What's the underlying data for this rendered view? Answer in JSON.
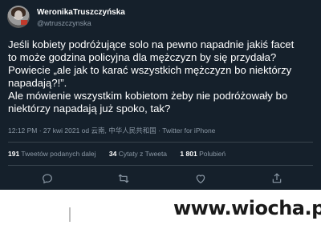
{
  "author": {
    "display_name": "WeronikaTruszczyńska",
    "handle": "@wtruszczynska"
  },
  "tweet": {
    "lines": [
      "Jeśli kobiety podróżujące solo na pewno napadnie jakiś facet",
      "to może godzina policyjna dla mężczyzn by się przydała?",
      "Powiecie „ale jak to karać wszystkich mężczyzn bo niektórzy",
      "napadają?!”.",
      "Ale mówienie wszystkim kobietom żeby nie podróżowały bo",
      "niektórzy napadają już spoko, tak?"
    ],
    "meta": "12:12 PM · 27 kwi 2021 od 云南, 中华人民共和国 · Twitter for iPhone"
  },
  "stats": {
    "retweets_count": "191",
    "retweets_label": "Tweetów podanych dalej",
    "quotes_count": "34",
    "quotes_label": "Cytaty z Tweeta",
    "likes_count": "1 801",
    "likes_label": "Polubień"
  },
  "actions": {
    "icons": [
      "reply-icon",
      "retweet-icon",
      "like-icon",
      "share-icon"
    ],
    "icon_color": "#8b98a5"
  },
  "watermark": {
    "text": "www.wiocha.pl"
  },
  "colors": {
    "background": "#15202b",
    "text": "#ffffff",
    "secondary_text": "#8b98a5",
    "divider": "#38444d"
  }
}
